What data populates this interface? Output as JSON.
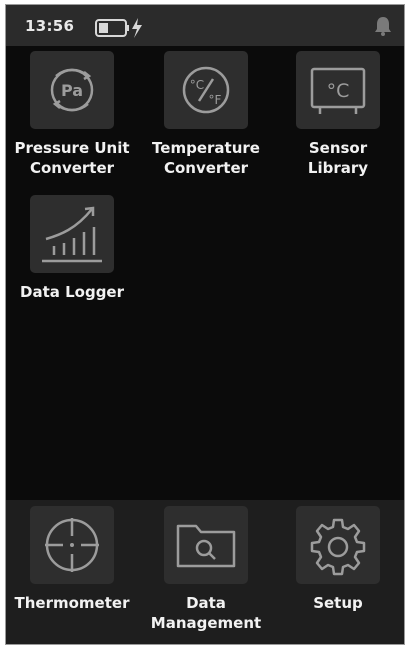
{
  "statusbar": {
    "time": "13:56",
    "battery_icon": "battery-charging-icon",
    "notification_icon": "bell-icon"
  },
  "apps": [
    {
      "label_line1": "Pressure Unit",
      "label_line2": "Converter",
      "icon": "pressure-pa-icon"
    },
    {
      "label_line1": "Temperature",
      "label_line2": "Converter",
      "icon": "temperature-convert-icon"
    },
    {
      "label_line1": "Sensor",
      "label_line2": "Library",
      "icon": "sensor-celsius-icon"
    },
    {
      "label_line1": "Data Logger",
      "icon": "rising-chart-icon"
    }
  ],
  "dock": [
    {
      "label_line1": "Thermometer",
      "icon": "crosshair-icon"
    },
    {
      "label_line1": "Data",
      "label_line2": "Management",
      "icon": "folder-search-icon"
    },
    {
      "label_line1": "Setup",
      "icon": "gear-icon"
    }
  ],
  "icon_text": {
    "pa": "Pa",
    "deg_c": "°C",
    "deg_f": "°F",
    "sensor_c": "°C"
  },
  "colors": {
    "background": "#0b0b0b",
    "statusbar": "#2b2b2b",
    "tile": "#2e2e2e",
    "dock": "#1e1e1e",
    "icon_stroke": "#9c9c9c",
    "text": "#f2f2f2"
  }
}
